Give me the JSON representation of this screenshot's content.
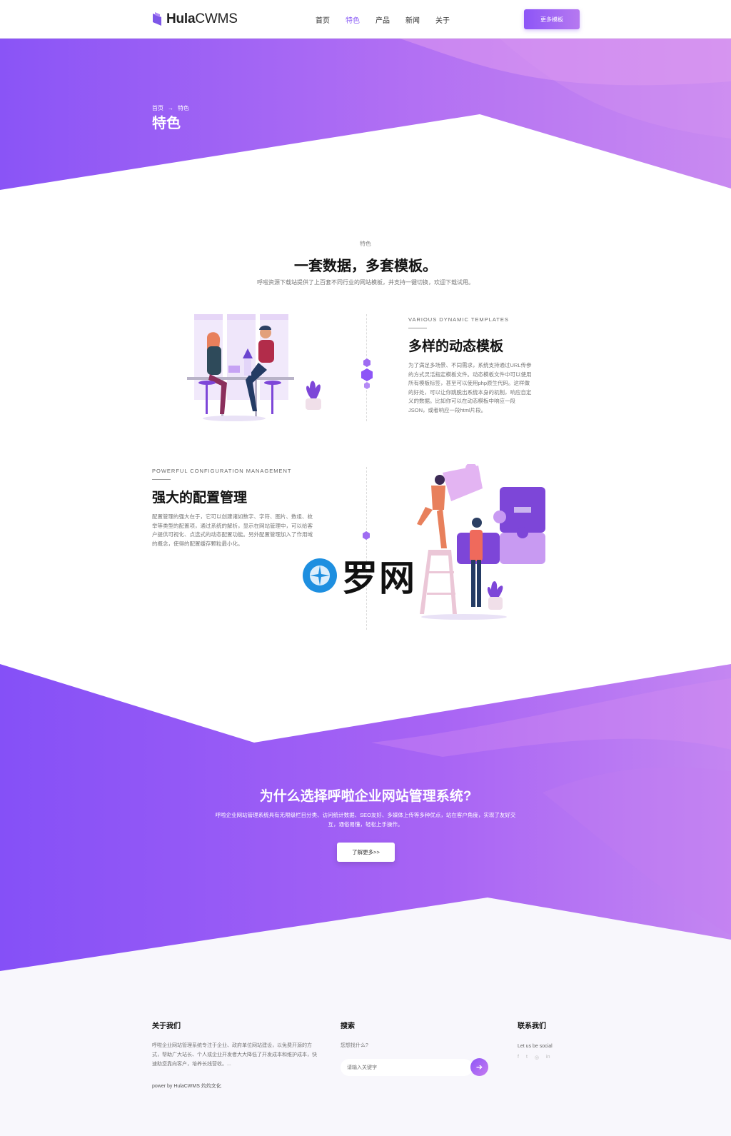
{
  "header": {
    "logo_bold": "Hula",
    "logo_light": "CWMS",
    "nav": [
      {
        "label": "首页",
        "active": false
      },
      {
        "label": "特色",
        "active": true
      },
      {
        "label": "产品",
        "active": false
      },
      {
        "label": "新闻",
        "active": false
      },
      {
        "label": "关于",
        "active": false
      }
    ],
    "cta_label": "更多模板"
  },
  "hero": {
    "breadcrumb": [
      "首页",
      "→",
      "特色"
    ],
    "title": "特色"
  },
  "intro": {
    "kicker": "特色",
    "title": "一套数据，多套模板。",
    "desc": "呼啦资源下载站提供了上百套不同行业的网站模板，并支持一键切换，欢迎下载试用。"
  },
  "features": [
    {
      "kicker": "VARIOUS DYNAMIC TEMPLATES",
      "title": "多样的动态模板",
      "text": "为了满足多场景、不同需求，系统支持通过URL传参的方式灵活指定模板文件。动态模板文件中可以使用所有模板标签，甚至可以使用php原生代码。这样做的好处，可以让你跳脱出系统本身的机制，响应自定义的数据。比如你可以在动态模板中响应一段JSON，或者响应一段html片段。"
    },
    {
      "kicker": "POWERFUL CONFIGURATION MANAGEMENT",
      "title": "强大的配置管理",
      "text": "配置管理的强大在于，它可以创建诸如数字、字符、图片、数组、枚举等类型的配置项，通过系统的解析，显示在网站管理中，可以给客户提供可视化、点选式的动态配置功能。另外配置管理加入了作用域的概念，使得的配置缓存颗粒最小化。"
    }
  ],
  "watermark": "罗网",
  "cta": {
    "title": "为什么选择呼啦企业网站管理系统?",
    "desc": "呼啦企业网站管理系统具有无限级栏目分类、访问统计数据、SEO友好、多媒体上传等多种优点，站在客户角度，实现了友好交互，通俗易懂，轻松上手操作。",
    "button": "了解更多>>"
  },
  "footer": {
    "about_title": "关于我们",
    "about_text": "呼啦企业网站管理系统专注于企业、政府单位网站建设，以免费开源的方式，帮助广大站长、个人或企业开发者大大降低了开发成本和维护成本，快速助您靠向客户，培养长线营收。...",
    "powered": "power by HulaCWMS 灼灼文化",
    "search_title": "搜索",
    "search_hint": "您想找什么?",
    "search_placeholder": "请输入关键字",
    "contact_title": "联系我们",
    "contact_hint": "Let us be social",
    "socials": [
      "f",
      "t",
      "◎",
      "in"
    ]
  },
  "colors": {
    "accent": "#8d55f7",
    "accent_light": "#c77cf0"
  }
}
